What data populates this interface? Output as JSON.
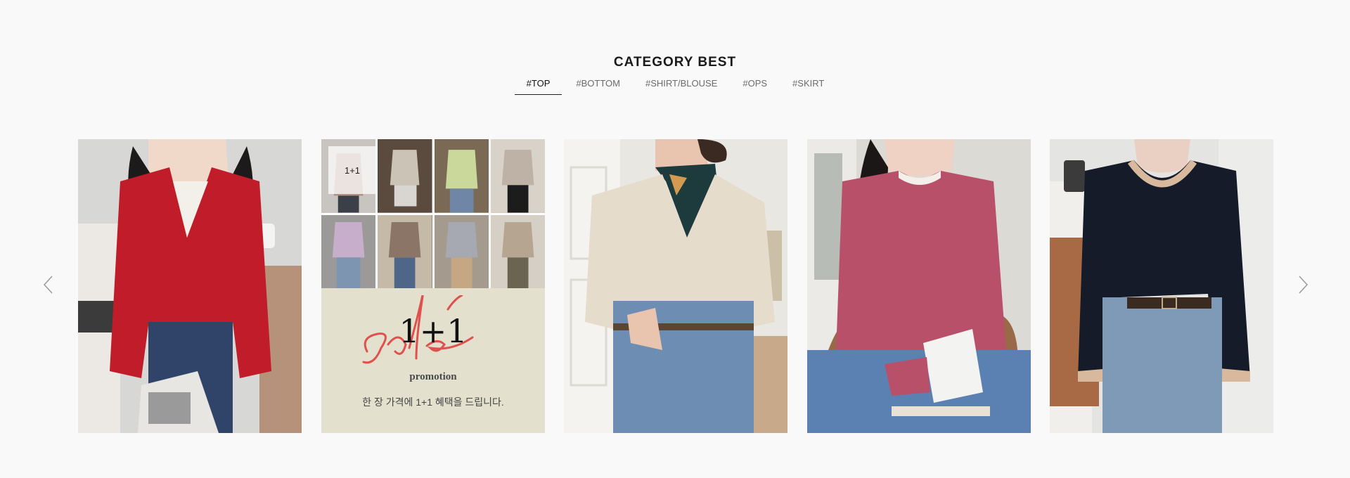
{
  "section": {
    "title": "CATEGORY BEST"
  },
  "tabs": [
    {
      "label": "#TOP",
      "active": true
    },
    {
      "label": "#BOTTOM",
      "active": false
    },
    {
      "label": "#SHIRT/BLOUSE",
      "active": false
    },
    {
      "label": "#OPS",
      "active": false
    },
    {
      "label": "#SKIRT",
      "active": false
    }
  ],
  "carousel": {
    "prev_icon": "chevron-left-icon",
    "next_icon": "chevron-right-icon",
    "products": [
      {
        "image": "model-red-cardigan",
        "colors": {
          "garment": "#c11c2a",
          "background": "#d7d7d5"
        }
      },
      {
        "image": "promo-collage",
        "badge": "1+1",
        "sale_script": "sale",
        "sale_number": "1+1",
        "promo_label": "promotion",
        "promo_description": "한 장 가격에 1+1 혜택을 드립니다.",
        "colors": {
          "panel": "#e3e1ce",
          "script": "#e0504d"
        }
      },
      {
        "image": "model-beige-blouse-scarf",
        "colors": {
          "garment": "#e6dccb",
          "background": "#e9e7e2"
        }
      },
      {
        "image": "model-pink-cardigan",
        "colors": {
          "garment": "#b85069",
          "background": "#dcdad5"
        }
      },
      {
        "image": "model-navy-knit-top",
        "colors": {
          "garment": "#151b28",
          "background": "#e4e4e2"
        }
      }
    ]
  }
}
